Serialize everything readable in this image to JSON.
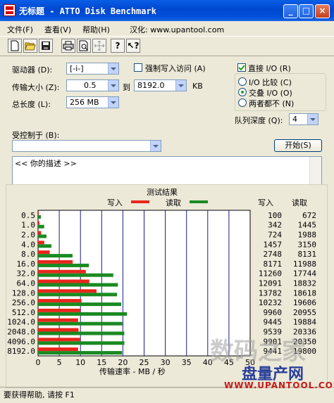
{
  "window": {
    "title": "无标题 - ATTO Disk Benchmark",
    "buttons": {
      "minimize": "_",
      "maximize": "□",
      "close": "×"
    }
  },
  "menu": {
    "file": "文件(F)",
    "view": "查看(V)",
    "help": "帮助(H)",
    "localized": "汉化: www.upantool.com"
  },
  "toolbar": {
    "icons": [
      "new-file-icon",
      "open-folder-icon",
      "save-icon",
      "print-icon",
      "print-preview-icon",
      "move-icon",
      "help-icon",
      "context-help-icon"
    ]
  },
  "form": {
    "drive_label": "驱动器 (D):",
    "drive_value": "[-i-]",
    "force_write_label": "强制写入访问 (A)",
    "direct_io_label": "直接 I/O (R)",
    "transfer_label": "传输大小 (Z):",
    "transfer_from": "0.5",
    "to_label": "到",
    "transfer_to": "8192.0",
    "kb_label": "KB",
    "total_label": "总长度 (L):",
    "total_value": "256 MB",
    "io_compare_label": "I/O 比较 (C)",
    "overlapped_label": "交叠 I/O (O)",
    "neither_label": "两者都不 (N)",
    "queue_label": "队列深度 (Q):",
    "queue_value": "4",
    "controlled_label": "受控制于 (B):",
    "controlled_value": "",
    "start_button": "开始(S)",
    "description": "<<  你的描述   >>"
  },
  "chart_data": {
    "type": "bar",
    "title": "测试结果",
    "legend_write": "写入",
    "legend_read": "读取",
    "xlabel": "传输速率 - MB / 秒",
    "xlim": [
      0,
      50
    ],
    "xticks": [
      "0",
      "5",
      "10",
      "15",
      "20",
      "25",
      "30",
      "35",
      "40",
      "45",
      "50"
    ],
    "col_write": "写入",
    "col_read": "读取",
    "categories": [
      "0.5",
      "1.0",
      "2.0",
      "4.0",
      "8.0",
      "16.0",
      "32.0",
      "64.0",
      "128.0",
      "256.0",
      "512.0",
      "1024.0",
      "2048.0",
      "4096.0",
      "8192.0"
    ],
    "series": [
      {
        "name": "写入",
        "color": "#e8261c",
        "values": [
          0.1,
          0.34,
          0.72,
          1.46,
          2.75,
          8.17,
          11.26,
          12.09,
          13.78,
          10.23,
          9.96,
          9.45,
          9.54,
          9.9,
          9.44
        ],
        "labels": [
          "100",
          "342",
          "724",
          "1457",
          "2748",
          "8171",
          "11260",
          "12091",
          "13782",
          "10232",
          "9960",
          "9445",
          "9539",
          "9901",
          "9441"
        ]
      },
      {
        "name": "读取",
        "color": "#1a8a22",
        "values": [
          0.67,
          1.45,
          1.99,
          3.15,
          8.13,
          11.99,
          17.74,
          18.83,
          18.62,
          19.61,
          20.96,
          19.88,
          20.34,
          20.35,
          19.8
        ],
        "labels": [
          "672",
          "1445",
          "1988",
          "3150",
          "8131",
          "11988",
          "17744",
          "18832",
          "18618",
          "19606",
          "20955",
          "19884",
          "20336",
          "20350",
          "19800"
        ]
      }
    ]
  },
  "status": {
    "text": "要获得帮助, 请按 F1"
  },
  "watermark": {
    "line1": "数码之家",
    "line2": "盘量产网",
    "url": "WWW.UPANTOOL.COM"
  }
}
